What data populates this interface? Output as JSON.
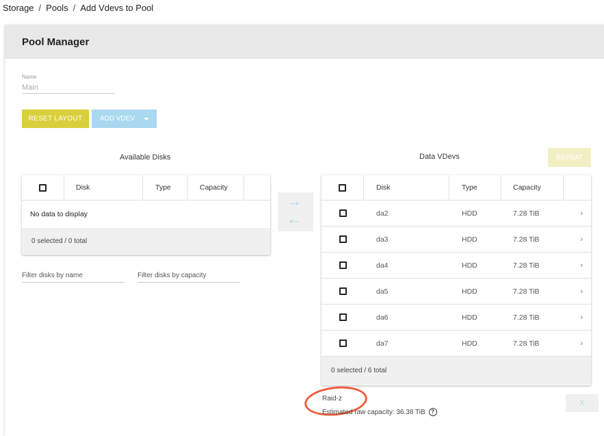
{
  "breadcrumb": [
    "Storage",
    "Pools",
    "Add Vdevs to Pool"
  ],
  "header": {
    "title": "Pool Manager"
  },
  "name_field": {
    "label": "Name",
    "value": "Main"
  },
  "buttons": {
    "reset_layout": "RESET LAYOUT",
    "add_vdev": "ADD VDEV",
    "repeat": "REPEAT",
    "close": "X"
  },
  "available": {
    "title": "Available Disks",
    "columns": [
      "Disk",
      "Type",
      "Capacity"
    ],
    "empty_text": "No data to display",
    "footer": "0 selected / 0 total"
  },
  "filters": {
    "name_placeholder": "Filter disks by name",
    "capacity_placeholder": "Filter disks by capacity"
  },
  "data_vdevs": {
    "title": "Data VDevs",
    "columns": [
      "Disk",
      "Type",
      "Capacity"
    ],
    "rows": [
      {
        "disk": "da2",
        "type": "HDD",
        "capacity": "7.28 TiB"
      },
      {
        "disk": "da3",
        "type": "HDD",
        "capacity": "7.28 TiB"
      },
      {
        "disk": "da4",
        "type": "HDD",
        "capacity": "7.28 TiB"
      },
      {
        "disk": "da5",
        "type": "HDD",
        "capacity": "7.28 TiB"
      },
      {
        "disk": "da6",
        "type": "HDD",
        "capacity": "7.28 TiB"
      },
      {
        "disk": "da7",
        "type": "HDD",
        "capacity": "7.28 TiB"
      }
    ],
    "footer": "0 selected / 6 total"
  },
  "layout_type": "Raid-z",
  "estimated_capacity": "Estimated raw capacity: 36.38 TiB",
  "icons": {
    "help": "help-circle-icon",
    "move_right": "arrow-right-icon",
    "move_left": "arrow-left-icon",
    "expand": "chevron-right-icon",
    "dropdown": "caret-down-icon"
  },
  "colors": {
    "reset_button": "#d9cf3c",
    "add_vdev_button": "#a9d8ef",
    "annotation": "#f05a3a"
  }
}
